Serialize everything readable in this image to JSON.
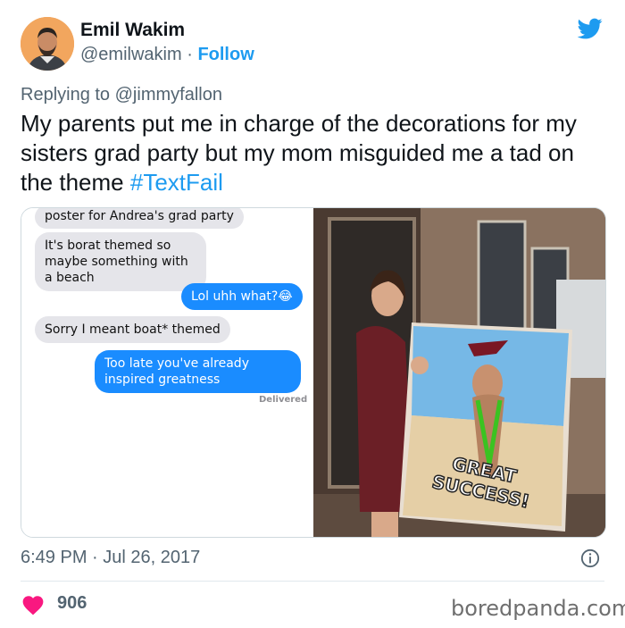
{
  "author": {
    "name": "Emil Wakim",
    "handle": "@emilwakim",
    "separator": " · ",
    "follow_label": "Follow"
  },
  "reply": {
    "prefix": "Replying to ",
    "mention": "@jimmyfallon"
  },
  "tweet": {
    "text": "My parents put me in charge of the decorations for my sisters grad party but my mom misguided me a tad on the theme ",
    "hashtag": "#TextFail"
  },
  "chat": {
    "messages": [
      {
        "side": "received",
        "text": "poster for Andrea's grad party"
      },
      {
        "side": "received",
        "text": "It's borat themed so maybe something with a beach"
      },
      {
        "side": "sent",
        "text": "Lol uhh what?😂"
      },
      {
        "side": "received",
        "text": "Sorry I meant boat* themed"
      },
      {
        "side": "sent",
        "text": "Too late you've already inspired greatness"
      }
    ],
    "delivered": "Delivered"
  },
  "photo": {
    "poster_text_line1": "GREAT",
    "poster_text_line2": "SUCCESS!"
  },
  "timestamp": "6:49 PM · Jul 26, 2017",
  "likes": "906",
  "watermark": "boredpanda.com",
  "colors": {
    "link": "#1d9bf0",
    "heart": "#f91880",
    "imessage_blue": "#1a8cff",
    "imessage_gray": "#e5e5ea"
  },
  "icons": [
    "twitter-bird-icon",
    "info-icon",
    "heart-icon"
  ]
}
